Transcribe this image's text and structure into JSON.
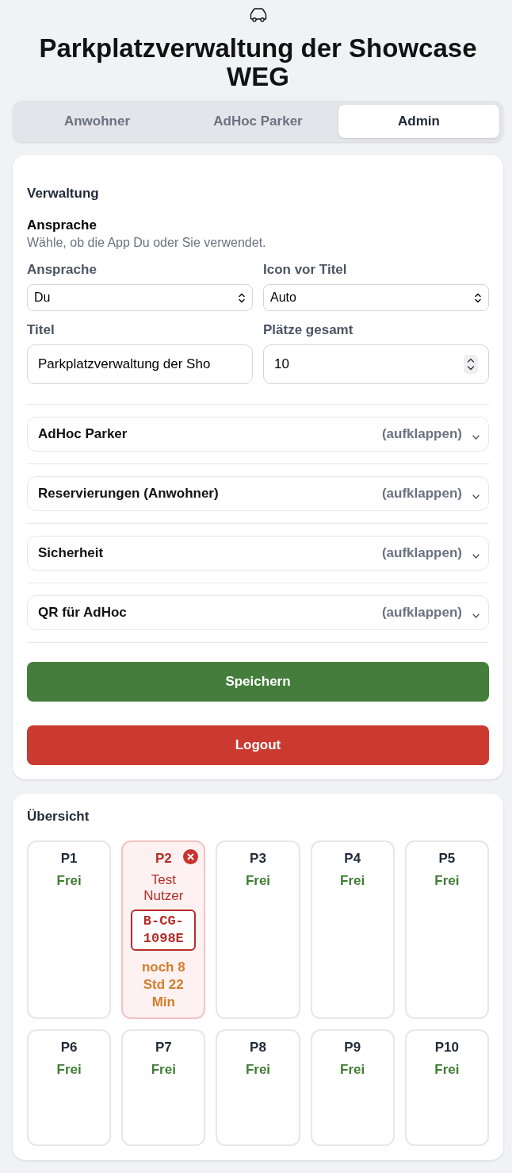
{
  "header": {
    "title": "Parkplatzverwaltung der Showcase WEG"
  },
  "tabs": [
    {
      "label": "Anwohner",
      "selected": false
    },
    {
      "label": "AdHoc Parker",
      "selected": false
    },
    {
      "label": "Admin",
      "selected": true
    }
  ],
  "admin_card": {
    "heading": "Verwaltung",
    "section_title": "Ansprache",
    "section_hint": "Wähle, ob die App Du oder Sie verwendet.",
    "fields": [
      {
        "kind": "select",
        "label": "Ansprache",
        "value": "Du"
      },
      {
        "kind": "select",
        "label": "Icon vor Titel",
        "value": "Auto"
      },
      {
        "kind": "text",
        "label": "Titel",
        "value": "Parkplatzverwaltung der Sho"
      },
      {
        "kind": "number",
        "label": "Plätze gesamt",
        "value": "10"
      }
    ],
    "sections": [
      {
        "title": "AdHoc Parker",
        "hint": "(aufklappen)",
        "expanded": false
      },
      {
        "title": "Reservierungen (Anwohner)",
        "hint": "(aufklappen)",
        "expanded": false
      },
      {
        "title": "Sicherheit",
        "hint": "(aufklappen)",
        "expanded": false
      },
      {
        "title": "QR für AdHoc",
        "hint": "(aufklappen)",
        "expanded": false
      }
    ],
    "buttons": [
      {
        "kind": "primary",
        "label": "Speichern"
      },
      {
        "kind": "danger",
        "label": "Logout"
      }
    ]
  },
  "overview": {
    "heading": "Übersicht",
    "spots": [
      {
        "label": "P1",
        "occupied": false,
        "status": "Frei"
      },
      {
        "label": "P2",
        "occupied": true,
        "user": "Test Nutzer",
        "plate": "B-CG-1098E",
        "remaining": "noch 8 Std 22 Min"
      },
      {
        "label": "P3",
        "occupied": false,
        "status": "Frei"
      },
      {
        "label": "P4",
        "occupied": false,
        "status": "Frei"
      },
      {
        "label": "P5",
        "occupied": false,
        "status": "Frei"
      },
      {
        "label": "P6",
        "occupied": false,
        "status": "Frei"
      },
      {
        "label": "P7",
        "occupied": false,
        "status": "Frei"
      },
      {
        "label": "P8",
        "occupied": false,
        "status": "Frei"
      },
      {
        "label": "P9",
        "occupied": false,
        "status": "Frei"
      },
      {
        "label": "P10",
        "occupied": false,
        "status": "Frei"
      }
    ]
  }
}
